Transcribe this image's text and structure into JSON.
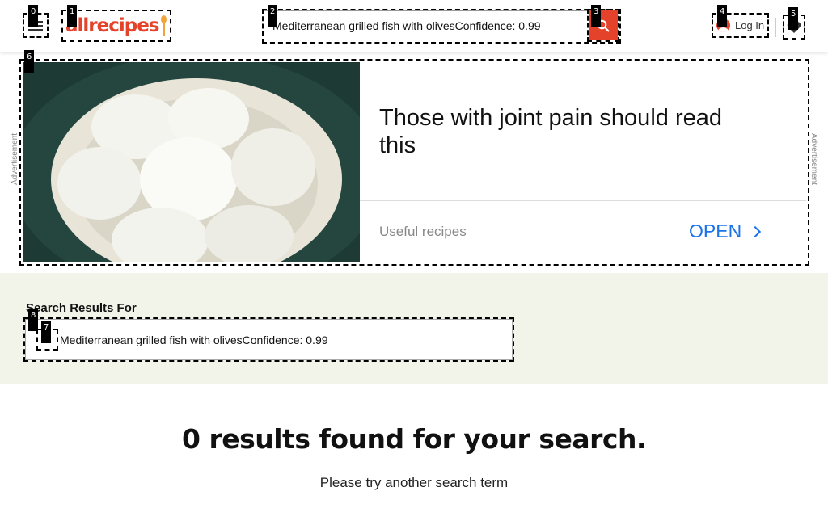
{
  "header": {
    "logo_text": "allrecipes",
    "search_value": "Mediterranean grilled fish with olivesConfidence: 0.99",
    "login_label": "Log In"
  },
  "advertisement": {
    "side_label": "Advertisement",
    "headline": "Those with joint pain should read this",
    "source": "Useful recipes",
    "cta_label": "OPEN"
  },
  "search_results": {
    "label": "Search Results For",
    "query": "Mediterranean grilled fish with olivesConfidence: 0.99"
  },
  "empty_state": {
    "title": "0 results found for your search.",
    "subtitle": "Please try another search term"
  },
  "markers": [
    "0",
    "1",
    "2",
    "3",
    "4",
    "5",
    "6",
    "7",
    "8"
  ],
  "colors": {
    "brand": "#e5422c",
    "accent_blue": "#1a73e8",
    "results_band": "#f2f3e9"
  }
}
